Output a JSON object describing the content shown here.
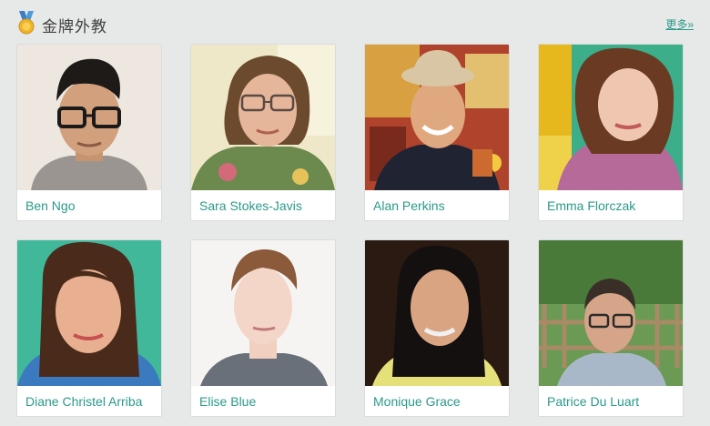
{
  "header": {
    "title": "金牌外教",
    "more_label": "更多»",
    "accent_color": "#2a9a8a",
    "icon": "medal-icon"
  },
  "teachers": [
    {
      "name": "Ben Ngo"
    },
    {
      "name": "Sara Stokes-Javis"
    },
    {
      "name": "Alan Perkins"
    },
    {
      "name": "Emma Florczak"
    },
    {
      "name": "Diane Christel Arriba"
    },
    {
      "name": "Elise Blue"
    },
    {
      "name": "Monique Grace"
    },
    {
      "name": "Patrice Du Luart"
    }
  ]
}
